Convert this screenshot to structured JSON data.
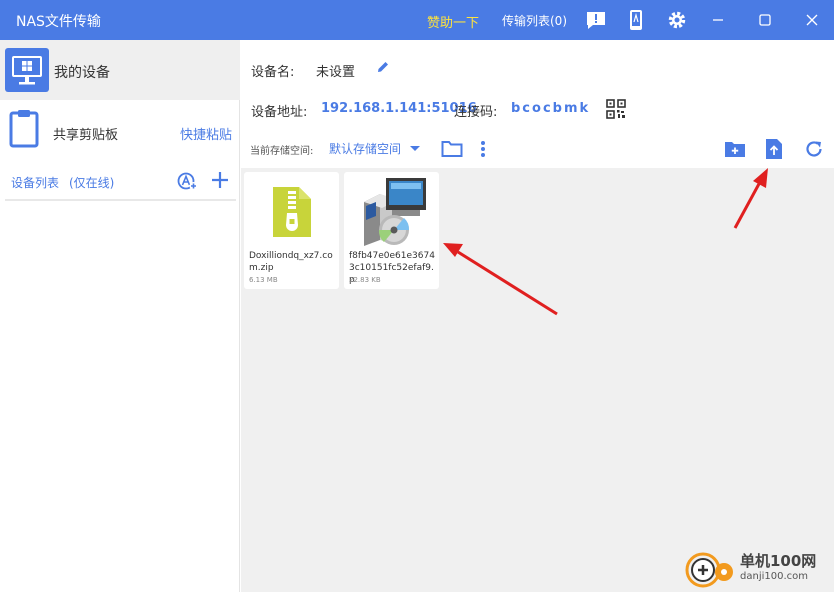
{
  "window": {
    "title": "NAS文件传输",
    "sponsor_label": "赞助一下",
    "transfer_list_label": "传输列表(0)",
    "icons": [
      "feedback-icon",
      "phone-icon",
      "gear-icon",
      "minimize-icon",
      "maximize-icon",
      "close-icon"
    ]
  },
  "sidebar": {
    "my_device_label": "我的设备",
    "clipboard_label": "共享剪贴板",
    "quick_paste_label": "快捷粘贴",
    "device_list_label": "设备列表",
    "device_list_sub": "(仅在线)"
  },
  "device": {
    "name_label": "设备名:",
    "name_value": "未设置",
    "address_label": "设备地址:",
    "address_value": "192.168.1.141:51016",
    "code_label": "连接码:",
    "code_value": "bcocbmk"
  },
  "toolbar": {
    "storage_label": "当前存储空间:",
    "storage_value": "默认存储空间"
  },
  "files": [
    {
      "name": "Doxilliondq_xz7.com.zip",
      "size": "6.13 MB",
      "type": "zip"
    },
    {
      "name": "f8fb47e0e61e36743c10151fc52efaf9.p",
      "size": "22.83 KB",
      "type": "installer"
    }
  ],
  "watermark": {
    "text": "单机100网",
    "sub": "danji100.com"
  },
  "colors": {
    "accent": "#4a7be4",
    "sponsor": "#ffe33d",
    "zip_green": "#c8d43a",
    "arrow_red": "#e02020"
  }
}
